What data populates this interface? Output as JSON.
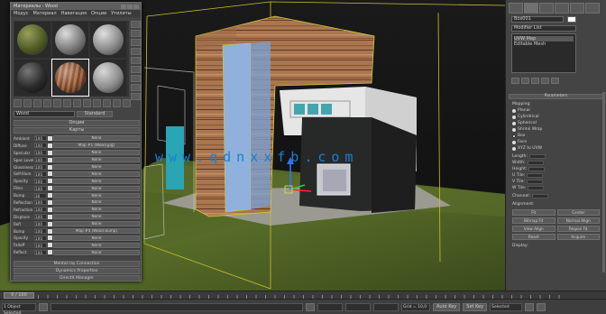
{
  "app": {
    "material_editor": {
      "title": "Материалы - Wood",
      "menu": [
        "Модус",
        "Материал",
        "Навигация",
        "Опции",
        "Утилиты"
      ],
      "material_name": "Wood",
      "material_type": "Standard",
      "rollout_titles": [
        "Опции",
        "Карты"
      ],
      "map_rows": [
        {
          "label": "Ambient",
          "amount": "100",
          "map": "None"
        },
        {
          "label": "Diffuse",
          "amount": "100",
          "map": "Map #1 (Wood.jpg)"
        },
        {
          "label": "Specular",
          "amount": "100",
          "map": "None"
        },
        {
          "label": "Spec Level",
          "amount": "100",
          "map": "None"
        },
        {
          "label": "Glossiness",
          "amount": "100",
          "map": "None"
        },
        {
          "label": "Self-Illum",
          "amount": "100",
          "map": "None"
        },
        {
          "label": "Opacity",
          "amount": "100",
          "map": "None"
        },
        {
          "label": "Filter",
          "amount": "100",
          "map": "None"
        },
        {
          "label": "Bump",
          "amount": "30",
          "map": "None"
        },
        {
          "label": "Reflection",
          "amount": "100",
          "map": "None"
        },
        {
          "label": "Refraction",
          "amount": "100",
          "map": "None"
        },
        {
          "label": "Displace",
          "amount": "100",
          "map": "None"
        },
        {
          "label": "Refl",
          "amount": "100",
          "map": "None"
        },
        {
          "label": "Bump",
          "amount": "100",
          "map": "Map #4 (Wood Bump)"
        },
        {
          "label": "Opacity",
          "amount": "100",
          "map": "None"
        },
        {
          "label": "Falloff",
          "amount": "100",
          "map": "None"
        },
        {
          "label": "Reflect",
          "amount": "100",
          "map": "None"
        }
      ],
      "bottom_rollouts": [
        "Mental ray Connection",
        "Dynamics Properties",
        "DirectX Manager"
      ]
    },
    "viewport": {
      "watermark": "www.qdnxxfb.com"
    },
    "command_panel": {
      "object_name": "Box001",
      "modifier_list": "Modifier List",
      "stack_items": [
        "UVW Map",
        "Editable Mesh"
      ],
      "rollout_params": "Parameters",
      "mapping_label": "Mapping:",
      "mapping_options": [
        "Planar",
        "Cylindrical",
        "Spherical",
        "Shrink Wrap",
        "Box",
        "Face",
        "XYZ to UVW"
      ],
      "length_label": "Length:",
      "width_label": "Width:",
      "height_label": "Height:",
      "tiles": [
        "U Tile:",
        "V Tile:",
        "W Tile:"
      ],
      "channel_label": "Channel:",
      "alignment_label": "Alignment:",
      "align_buttons": [
        "Fit",
        "Center",
        "Bitmap Fit",
        "Normal Align",
        "View Align",
        "Region Fit",
        "Reset",
        "Acquire"
      ],
      "display_label": "Display:"
    },
    "timeline": {
      "frame_slider": "0 / 100"
    },
    "statusbar": {
      "selection": "1 Object Selected",
      "x_value": "",
      "y_value": "",
      "z_value": "",
      "grid": "Grid = 10,0",
      "autokey": "Auto Key",
      "setkey": "Set Key",
      "selected": "Selected"
    }
  }
}
